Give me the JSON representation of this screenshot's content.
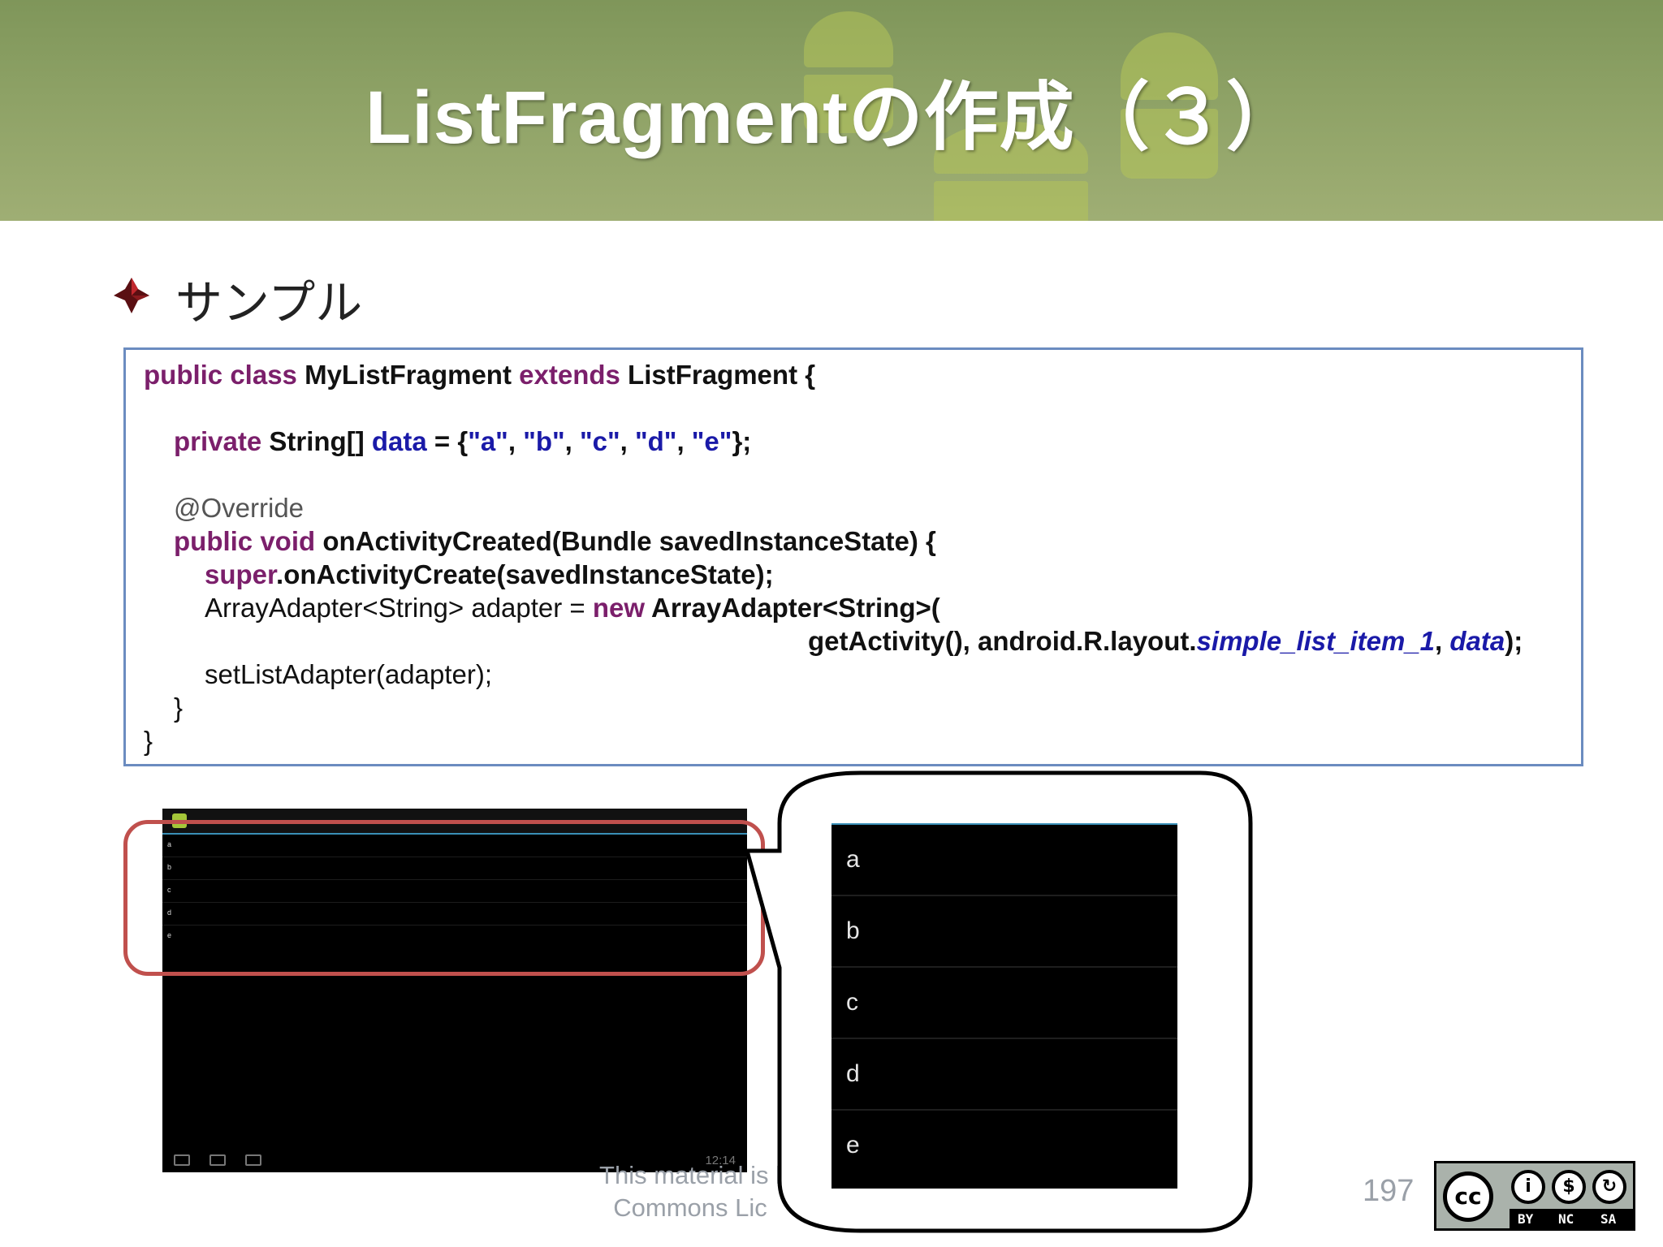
{
  "header": {
    "title": "ListFragmentの作成（３）"
  },
  "bullet": {
    "text": "サンプル"
  },
  "code": {
    "lines": [
      [
        {
          "t": "public class ",
          "c": "kw"
        },
        {
          "t": "MyListFragment ",
          "c": "b"
        },
        {
          "t": "extends ",
          "c": "kw"
        },
        {
          "t": "ListFragment {",
          "c": "b"
        }
      ],
      [],
      [
        {
          "t": "private ",
          "c": "kw"
        },
        {
          "t": "String[] ",
          "c": "b"
        },
        {
          "t": "data",
          "c": "fld"
        },
        {
          "t": " = {",
          "c": "b"
        },
        {
          "t": "\"a\"",
          "c": "str"
        },
        {
          "t": ", ",
          "c": "b"
        },
        {
          "t": "\"b\"",
          "c": "str"
        },
        {
          "t": ", ",
          "c": "b"
        },
        {
          "t": "\"c\"",
          "c": "str"
        },
        {
          "t": ", ",
          "c": "b"
        },
        {
          "t": "\"d\"",
          "c": "str"
        },
        {
          "t": ", ",
          "c": "b"
        },
        {
          "t": "\"e\"",
          "c": "str"
        },
        {
          "t": "};",
          "c": "b"
        }
      ],
      [],
      [
        {
          "t": "@Override",
          "c": "ann"
        }
      ],
      [
        {
          "t": "public void ",
          "c": "kw"
        },
        {
          "t": "onActivityCreated(Bundle savedInstanceState) {",
          "c": "b"
        }
      ],
      [
        {
          "t": "super",
          "c": "kw"
        },
        {
          "t": ".onActivityCreate(savedInstanceState);",
          "c": "b"
        }
      ],
      [
        {
          "t": "ArrayAdapter<String> adapter = ",
          "c": ""
        },
        {
          "t": "new ",
          "c": "kw"
        },
        {
          "t": "ArrayAdapter<String>(",
          "c": "b"
        }
      ],
      [
        {
          "t": "getActivity(), android.R.layout.",
          "c": "b"
        },
        {
          "t": "simple_list_item_1",
          "c": "it"
        },
        {
          "t": ", ",
          "c": "b"
        },
        {
          "t": "data",
          "c": "it"
        },
        {
          "t": ");",
          "c": "b"
        }
      ],
      [
        {
          "t": "setListAdapter(adapter);",
          "c": ""
        }
      ],
      [
        {
          "t": "}",
          "c": ""
        }
      ],
      [
        {
          "t": "}",
          "c": ""
        }
      ]
    ]
  },
  "tablet": {
    "list_items": [
      "a",
      "b",
      "c",
      "d",
      "e"
    ],
    "time": "12:14"
  },
  "zoomed_list": {
    "items": [
      "a",
      "b",
      "c",
      "d",
      "e"
    ]
  },
  "footer": {
    "line1": "This material is l",
    "line2": "Commons Lic"
  },
  "page_number": "197",
  "license_badge": {
    "labels": [
      "BY",
      "NC",
      "SA"
    ]
  },
  "colors": {
    "keyword": "#7b1f6b",
    "field": "#1a1aa8",
    "highlight": "#c0504d",
    "code_border": "#6b8cc0"
  }
}
